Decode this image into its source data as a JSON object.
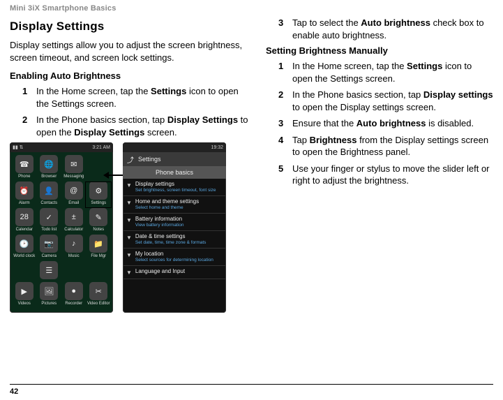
{
  "header": "Mini 3iX Smartphone Basics",
  "page_number": "42",
  "left": {
    "title": "Display Settings",
    "intro": "Display settings allow you to adjust the screen brightness, screen timeout, and screen lock settings.",
    "sub1": "Enabling Auto Brightness",
    "steps": [
      {
        "n": "1",
        "html": "In the Home screen, tap the <b>Settings</b> icon to open the Settings screen."
      },
      {
        "n": "2",
        "html": "In the Phone basics section, tap <b>Display Settings</b> to open the <b>Display Settings</b> screen."
      }
    ],
    "phone1": {
      "status_left": "",
      "status_right": "3:21 AM",
      "apps": [
        {
          "lbl": "Phone",
          "ico": "☎"
        },
        {
          "lbl": "Browser",
          "ico": "🌐"
        },
        {
          "lbl": "Messaging",
          "ico": "✉"
        },
        {
          "lbl": "",
          "ico": ""
        },
        {
          "lbl": "Alarm",
          "ico": "⏰"
        },
        {
          "lbl": "Contacts",
          "ico": "👤"
        },
        {
          "lbl": "Email",
          "ico": "@"
        },
        {
          "lbl": "Settings",
          "ico": "⚙"
        },
        {
          "lbl": "Calendar",
          "ico": "28"
        },
        {
          "lbl": "Todo list",
          "ico": "✓"
        },
        {
          "lbl": "Calculator",
          "ico": "±"
        },
        {
          "lbl": "Notes",
          "ico": "✎"
        },
        {
          "lbl": "World clock",
          "ico": "🕑"
        },
        {
          "lbl": "Camera",
          "ico": "📷"
        },
        {
          "lbl": "Music",
          "ico": "♪"
        },
        {
          "lbl": "File Mgr",
          "ico": "📁"
        },
        {
          "lbl": "",
          "ico": ""
        },
        {
          "lbl": "",
          "ico": "☰"
        },
        {
          "lbl": "",
          "ico": ""
        },
        {
          "lbl": "",
          "ico": ""
        },
        {
          "lbl": "Videos",
          "ico": "▶"
        },
        {
          "lbl": "Pictures",
          "ico": "🖼"
        },
        {
          "lbl": "Recorder",
          "ico": "●"
        },
        {
          "lbl": "Video Editor",
          "ico": "✂"
        }
      ]
    },
    "phone2": {
      "status_right": "19:32",
      "title": "Settings",
      "group": "Phone basics",
      "rows": [
        {
          "t1": "Display settings",
          "t2": "Set brightness, screen timeout, font size"
        },
        {
          "t1": "Home and theme settings",
          "t2": "Select home and theme"
        },
        {
          "t1": "Battery information",
          "t2": "View battery information"
        },
        {
          "t1": "Date & time settings",
          "t2": "Set date, time, time zone & formats"
        },
        {
          "t1": "My location",
          "t2": "Select sources for determining location"
        },
        {
          "t1": "Language and Input",
          "t2": ""
        }
      ]
    }
  },
  "right": {
    "steps_top": [
      {
        "n": "3",
        "html": "Tap to select the <b>Auto brightness</b> check box to enable auto brightness."
      }
    ],
    "sub": "Setting Brightness Manually",
    "steps": [
      {
        "n": "1",
        "html": "In the Home screen, tap the <b>Settings</b> icon to open the Settings screen."
      },
      {
        "n": "2",
        "html": "In the Phone basics section, tap <b>Display settings</b> to open the Display settings screen."
      },
      {
        "n": "3",
        "html": "Ensure that the <b>Auto brightness</b> is disabled."
      },
      {
        "n": "4",
        "html": "Tap <b>Brightness</b> from the Display settings screen to open the Brightness panel."
      },
      {
        "n": "5",
        "html": "Use your finger or stylus to move the slider left or right to adjust the brightness."
      }
    ]
  }
}
